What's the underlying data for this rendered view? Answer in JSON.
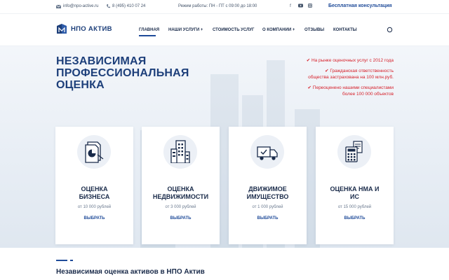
{
  "topbar": {
    "email": "info@npo-active.ru",
    "phone": "8 (495) 410 07 24",
    "hours": "Режим работы: ПН - ПТ с 09:00 до 18:00",
    "social": [
      "facebook-icon",
      "youtube-icon",
      "instagram-icon"
    ],
    "consult": "Бесплатная консультация"
  },
  "header": {
    "logo": "НПО АКТИВ",
    "nav": [
      {
        "label": "ГЛАВНАЯ"
      },
      {
        "label": "НАШИ УСЛУГИ +"
      },
      {
        "label": "СТОИМОСТЬ УСЛУГ"
      },
      {
        "label": "О КОМПАНИИ +"
      },
      {
        "label": "ОТЗЫВЫ"
      },
      {
        "label": "КОНТАКТЫ"
      }
    ]
  },
  "hero": {
    "title": [
      "НЕЗАВИСИМАЯ",
      "ПРОФЕССИОНАЛЬНАЯ",
      "ОЦЕНКА"
    ],
    "bullets": [
      [
        "✔ На рынке оценочных услуг с 2012 года"
      ],
      [
        "✔ Гражданская ответственность",
        "общества застрахована на 100 млн.руб."
      ],
      [
        "✔ Переоценено нашими специалистами",
        "более 100 000 объектов"
      ]
    ]
  },
  "cards": [
    {
      "name": [
        "ОЦЕНКА",
        "БИЗНЕСА"
      ],
      "price": "от 10 000 рублей",
      "choose": "ВЫБРАТЬ",
      "icon": "business-chart-icon"
    },
    {
      "name": [
        "ОЦЕНКА",
        "НЕДВИЖИМОСТИ"
      ],
      "price": "от 3 000 рублей",
      "choose": "ВЫБРАТЬ",
      "icon": "building-icon"
    },
    {
      "name": [
        "ДВИЖИМОЕ",
        "ИМУЩЕСТВО"
      ],
      "price": "от 1 000 рублей",
      "choose": "ВЫБРАТЬ",
      "icon": "truck-icon"
    },
    {
      "name": [
        "ОЦЕНКА НМА И",
        "ИС"
      ],
      "price": "от 15 000 рублей",
      "choose": "ВЫБРАТЬ",
      "icon": "calculator-icon"
    }
  ],
  "section": {
    "heading": "Независимая оценка активов в НПО Актив"
  },
  "colors": {
    "brand": "#1d3f7a",
    "accent": "#1f4b99",
    "red": "#d6202a"
  }
}
